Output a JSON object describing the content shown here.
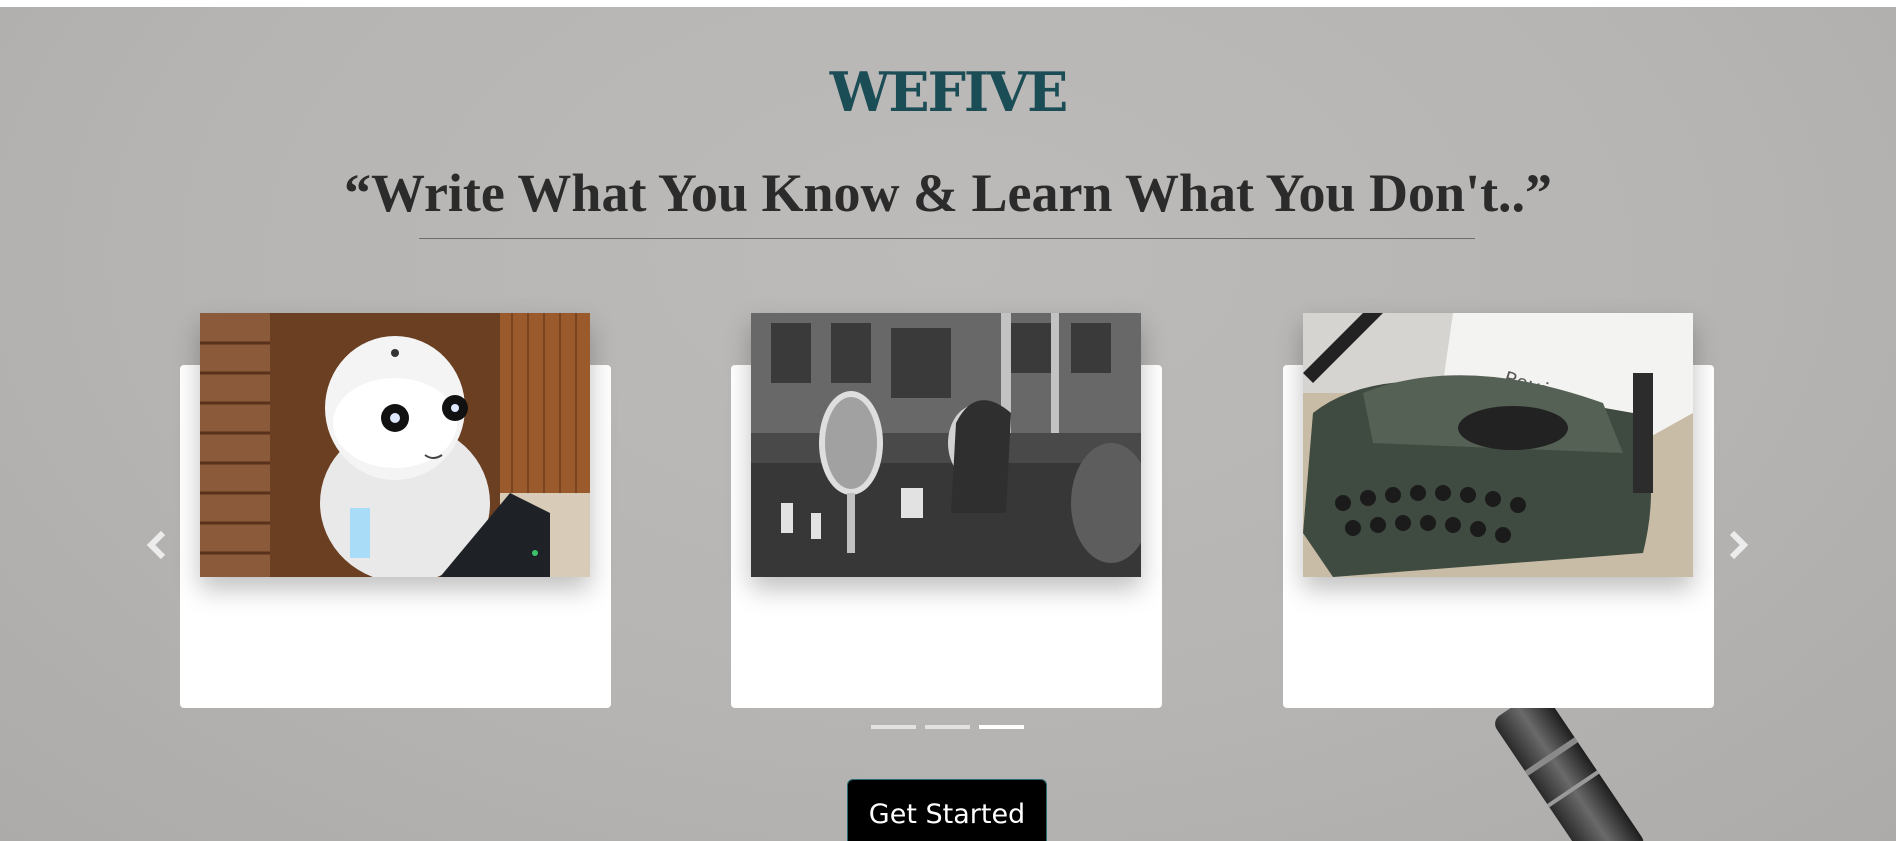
{
  "header": {
    "brand": "WEFIVE",
    "tagline": "“Write What You Know & Learn What You Don't..”"
  },
  "carousel": {
    "prev_icon": "chevron-left-icon",
    "next_icon": "chevron-right-icon",
    "slides": [
      {
        "image": "robot-photo"
      },
      {
        "image": "street-reflection-photo"
      },
      {
        "image": "typewriter-photo",
        "image_text": "Review"
      }
    ],
    "indicator_count": 3,
    "active_indicator": 3
  },
  "cta": {
    "label": "Get Started"
  },
  "colors": {
    "brand": "#1b4d56",
    "background": "#b7b5b3",
    "button": "#000000"
  }
}
